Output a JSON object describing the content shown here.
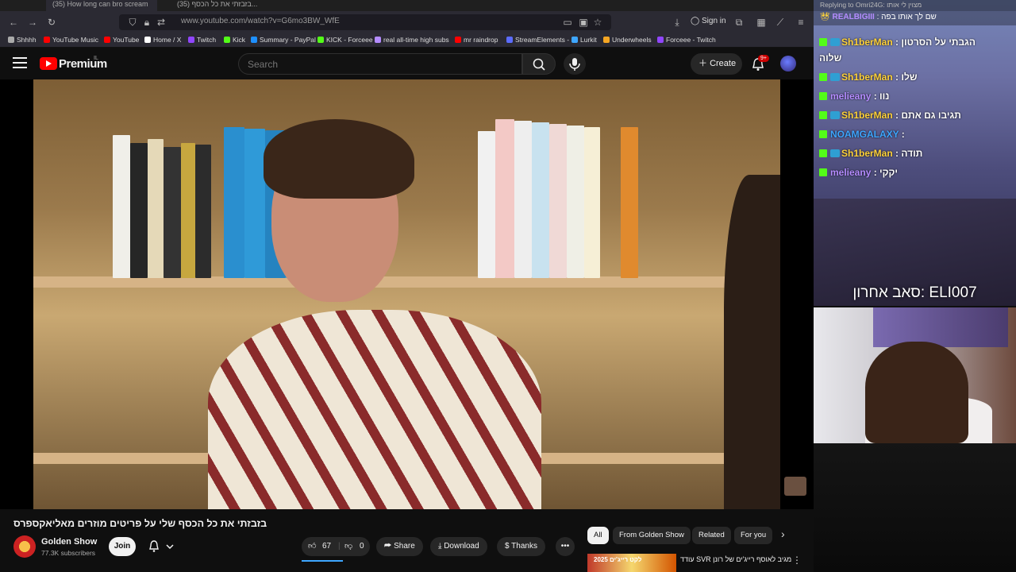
{
  "browser": {
    "tabs": [
      "(35) How long can bro scream",
      "(35) בזבזתי את כל הכסף..."
    ],
    "url": "www.youtube.com/watch?v=G6mo3BW_WfE",
    "sign_in": "Sign in",
    "bookmarks": [
      {
        "label": "Shhhh",
        "color": "#aaaaaa"
      },
      {
        "label": "YouTube Music",
        "color": "#ff0000"
      },
      {
        "label": "YouTube",
        "color": "#ff0000"
      },
      {
        "label": "Home / X",
        "color": "#ffffff"
      },
      {
        "label": "Twitch",
        "color": "#9146ff"
      },
      {
        "label": "Kick",
        "color": "#53fc18"
      },
      {
        "label": "Summary - PayPal",
        "color": "#1e90ff"
      },
      {
        "label": "KICK - Forceee",
        "color": "#53fc18"
      },
      {
        "label": "real all-time high subs",
        "color": "#b48cff"
      },
      {
        "label": "mr raindrop",
        "color": "#ff0000"
      },
      {
        "label": "StreamElements -",
        "color": "#5b6cff"
      },
      {
        "label": "Lurkit",
        "color": "#3ea6ff"
      },
      {
        "label": "Underwheels",
        "color": "#f5a623"
      },
      {
        "label": "Forceee - Twitch",
        "color": "#9146ff"
      }
    ]
  },
  "youtube": {
    "logo_text": "Premium",
    "logo_sup": "IL",
    "search_placeholder": "Search",
    "create_label": "Create",
    "notif_count": "9+"
  },
  "video": {
    "title": "בזבזתי את כל הכסף שלי על פריטים מוזרים מאליאקספרס",
    "channel": "Golden Show",
    "subscribers": "77.3K subscribers",
    "join_label": "Join",
    "likes": "67",
    "dislikes": "0",
    "share_label": "Share",
    "download_label": "Download",
    "thanks_label": "Thanks",
    "more_label": "•••"
  },
  "chips": [
    "All",
    "From Golden Show",
    "Related",
    "For you"
  ],
  "recommendation": {
    "title": "עודד SVR מגיב לאוסף רייג'ים של רונן",
    "thumb_text": "לקט רייג'ים 2025"
  },
  "stream_overlay": {
    "reply_text": "Replying to Omri24G: מצוין לי אותו",
    "badge_user": "REALBIGIII",
    "badge_text": "שם לך אותו בפה",
    "messages": [
      {
        "user": "Sh1berMan",
        "text": "הגבתי על הסרטון",
        "cls": "uname",
        "line2": "שלוה"
      },
      {
        "user": "Sh1berMan",
        "text": "שלו",
        "cls": "uname"
      },
      {
        "user": "melieany",
        "text": "נוו",
        "cls": "uname2"
      },
      {
        "user": "Sh1berMan",
        "text": "תגיבו גם אתם",
        "cls": "uname"
      },
      {
        "user": "NOAMGALAXY",
        "text": "",
        "cls": "uname3"
      },
      {
        "user": "Sh1berMan",
        "text": "תודה",
        "cls": "uname"
      },
      {
        "user": "melieany",
        "text": "יקקי",
        "cls": "uname2"
      }
    ],
    "last_sub": "סאב אחרון: ELI007"
  },
  "colors": {
    "accent": "#ff0000",
    "kick_green": "#53fc18",
    "progress": "#3ea6ff"
  }
}
